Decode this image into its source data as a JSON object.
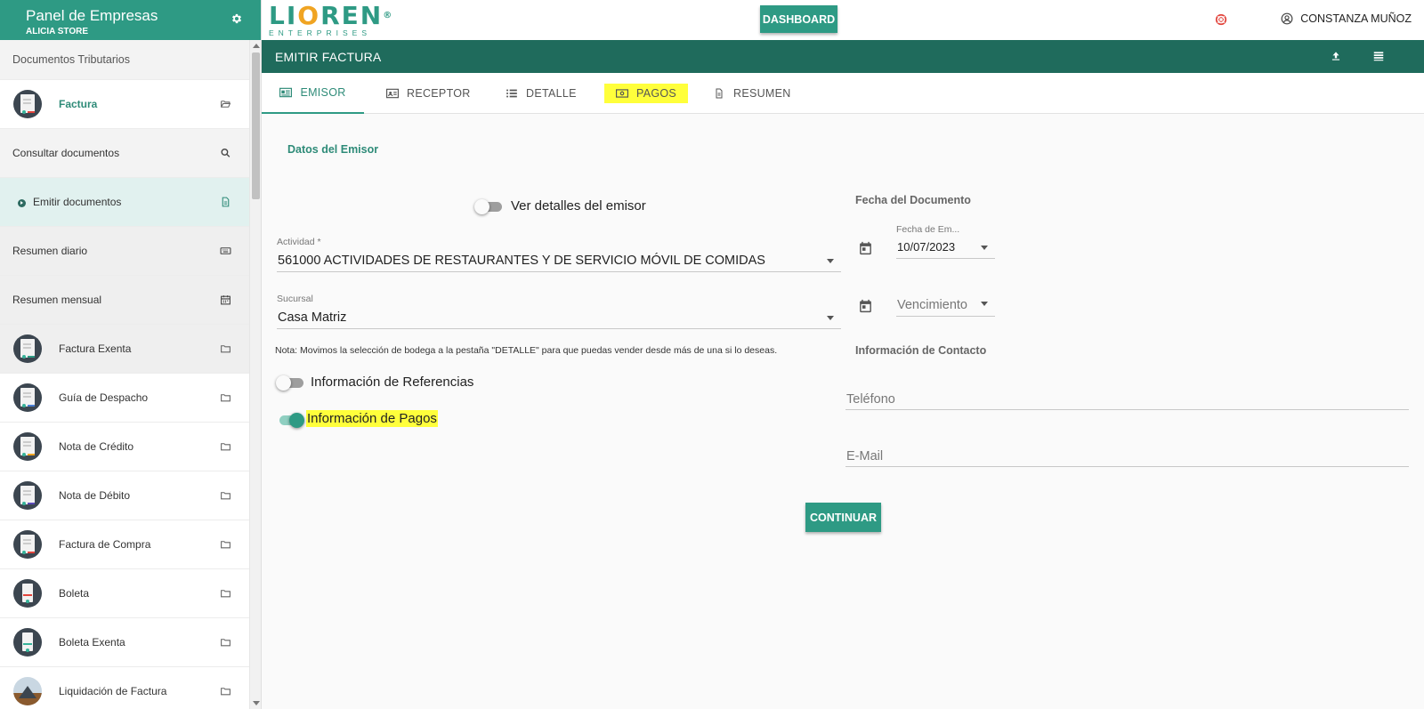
{
  "sidebar": {
    "title": "Panel de Empresas",
    "subtitle": "ALICIA STORE",
    "settings_icon": "gear-icon",
    "section_title": "Documentos Tributarios",
    "items": [
      {
        "label": "Factura",
        "icon": "folder-open-icon"
      },
      {
        "label": "Consultar documentos",
        "icon": "search-icon"
      },
      {
        "label": "Emitir documentos",
        "icon": "document-icon"
      },
      {
        "label": "Resumen diario",
        "icon": "keyboard-icon"
      },
      {
        "label": "Resumen mensual",
        "icon": "calendar-icon"
      },
      {
        "label": "Factura Exenta",
        "icon": "folder-icon"
      },
      {
        "label": "Guía de Despacho",
        "icon": "folder-icon"
      },
      {
        "label": "Nota de Crédito",
        "icon": "folder-icon"
      },
      {
        "label": "Nota de Débito",
        "icon": "folder-icon"
      },
      {
        "label": "Factura de Compra",
        "icon": "folder-icon"
      },
      {
        "label": "Boleta",
        "icon": "folder-icon"
      },
      {
        "label": "Boleta Exenta",
        "icon": "folder-icon"
      },
      {
        "label": "Liquidación de Factura",
        "icon": "folder-icon"
      }
    ]
  },
  "topbar": {
    "logo_text_1": "LI",
    "logo_text_o": "O",
    "logo_text_2": "REN",
    "logo_reg": "®",
    "logo_sub": "ENTERPRISES",
    "dashboard_label": "DASHBOARD",
    "user_name": "CONSTANZA MUÑOZ"
  },
  "page": {
    "title": "EMITIR FACTURA"
  },
  "tabs": [
    {
      "label": "EMISOR",
      "icon": "id-card-icon",
      "active": true
    },
    {
      "label": "RECEPTOR",
      "icon": "contact-card-icon"
    },
    {
      "label": "DETALLE",
      "icon": "list-icon"
    },
    {
      "label": "PAGOS",
      "icon": "money-icon",
      "highlighted": true
    },
    {
      "label": "RESUMEN",
      "icon": "document-icon"
    }
  ],
  "emisor": {
    "section_title": "Datos del Emisor",
    "ver_detalles_label": "Ver detalles del emisor",
    "ver_detalles_on": false,
    "actividad_label": "Actividad *",
    "actividad_value": "561000 ACTIVIDADES DE RESTAURANTES Y DE SERVICIO MÓVIL DE COMIDAS",
    "sucursal_label": "Sucursal",
    "sucursal_value": "Casa Matriz",
    "note": "Nota: Movimos la selección de bodega a la pestaña \"DETALLE\" para que puedas vender desde más de una si lo deseas.",
    "referencias_label": "Información de Referencias",
    "referencias_on": false,
    "pagos_label": "Información de Pagos",
    "pagos_on": true
  },
  "fecha": {
    "heading": "Fecha del Documento",
    "emision_label": "Fecha de Em...",
    "emision_value": "10/07/2023",
    "vencimiento_placeholder": "Vencimiento"
  },
  "contacto": {
    "heading": "Información de Contacto",
    "telefono_placeholder": "Teléfono",
    "email_placeholder": "E-Mail"
  },
  "continue_label": "CONTINUAR",
  "colors": {
    "primary": "#2e9a84",
    "header_dark": "#1f6b5c",
    "highlight": "#ffff3b",
    "logo_accent": "#f0a422"
  }
}
